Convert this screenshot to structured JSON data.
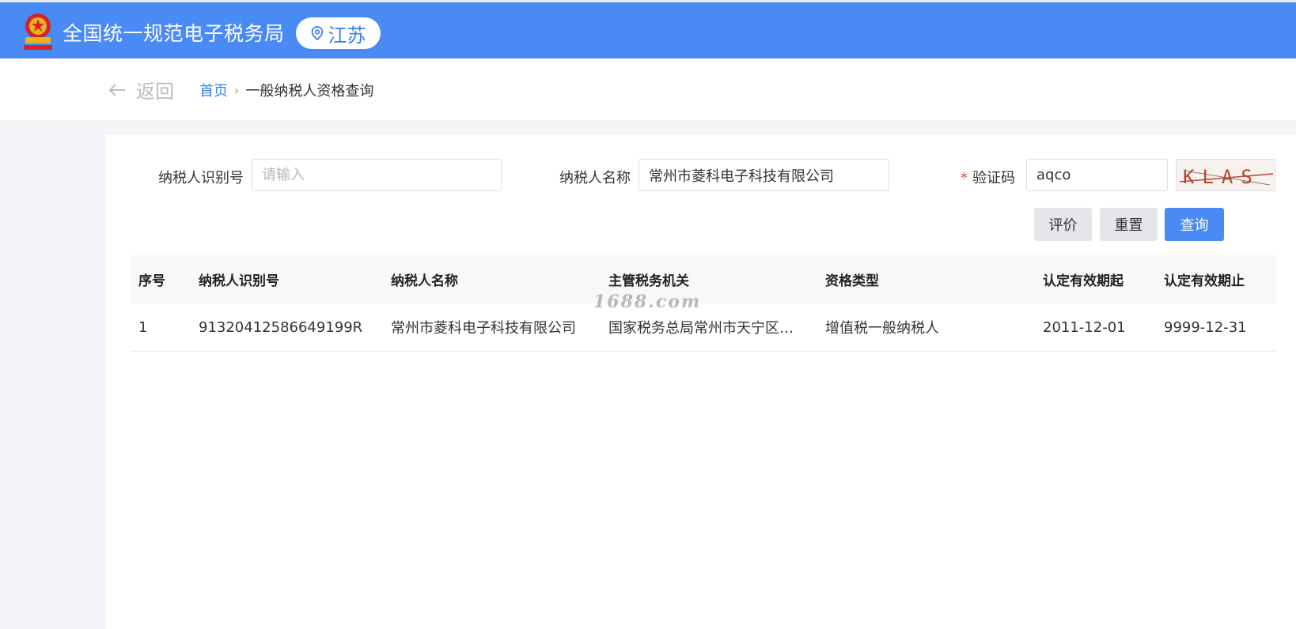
{
  "header": {
    "site_title": "全国统一规范电子税务局",
    "region": "江苏",
    "emblem_icon": "tax-emblem-icon",
    "location_icon": "location-pin-icon",
    "bar_color": "#4a8af4"
  },
  "nav": {
    "back_label": "返回",
    "back_icon": "arrow-left-icon",
    "breadcrumb_home": "首页",
    "breadcrumb_separator": "›",
    "breadcrumb_current": "一般纳税人资格查询"
  },
  "form": {
    "taxpayer_id_label": "纳税人识别号",
    "taxpayer_id_value": "",
    "taxpayer_id_placeholder": "请输入",
    "taxpayer_name_label": "纳税人名称",
    "taxpayer_name_value": "常州市菱科电子科技有限公司",
    "captcha_required_mark": "*",
    "captcha_label": "验证码",
    "captcha_value": "aqco",
    "captcha_image_text": "KLAS"
  },
  "buttons": {
    "evaluate": "评价",
    "reset": "重置",
    "query": "查询"
  },
  "table": {
    "headers": [
      "序号",
      "纳税人识别号",
      "纳税人名称",
      "主管税务机关",
      "资格类型",
      "认定有效期起",
      "认定有效期止"
    ],
    "rows": [
      [
        "1",
        "91320412586649199R",
        "常州市菱科电子科技有限公司",
        "国家税务总局常州市天宁区税...",
        "增值税一般纳税人",
        "2011-12-01",
        "9999-12-31"
      ]
    ]
  },
  "watermark": "1688.com"
}
